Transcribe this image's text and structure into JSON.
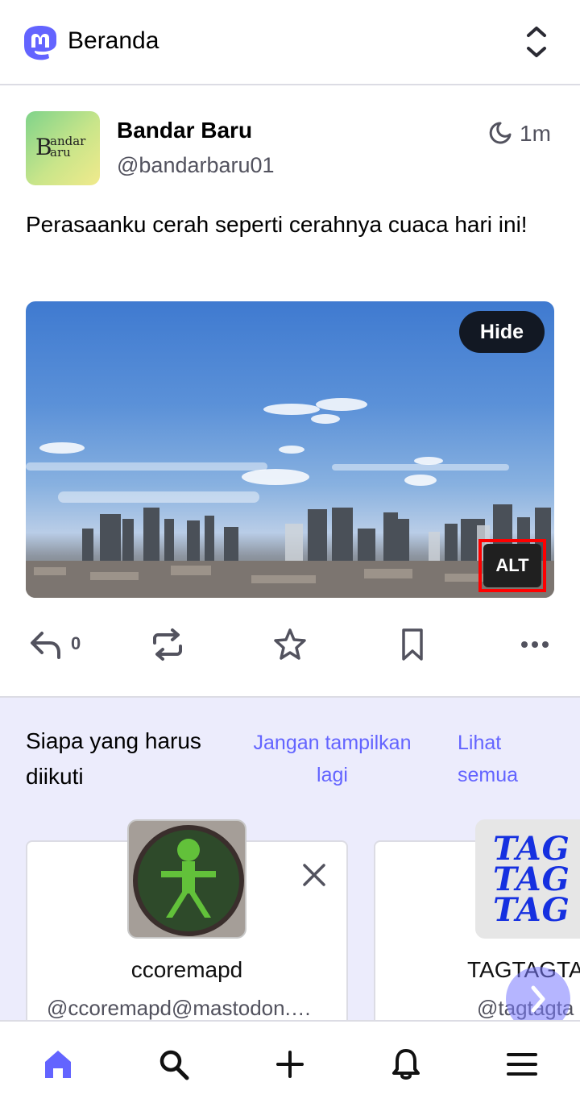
{
  "header": {
    "title": "Beranda",
    "logo_icon": "mastodon-logo-icon",
    "sort_icon": "chevron-up-down-icon"
  },
  "post": {
    "avatar_text_big": "B",
    "avatar_text_small1": "andar",
    "avatar_text_small2": "aru",
    "display_name": "Bandar Baru",
    "handle": "@bandarbaru01",
    "time": "1m",
    "visibility_icon": "moon-icon",
    "text": "Perasaanku cerah seperti cerahnya cuaca hari ini!",
    "media": {
      "hide_label": "Hide",
      "alt_label": "ALT"
    },
    "actions": {
      "reply_count": "0"
    }
  },
  "suggestions": {
    "title": "Siapa yang harus diikuti",
    "dismiss_label": "Jangan tampilkan lagi",
    "view_all_label": "Lihat semua",
    "cards": [
      {
        "name": "ccoremapd",
        "handle": "@ccoremapd@mastodon.…"
      },
      {
        "name": "TAGTAGTA",
        "handle": "@tagtagta",
        "avatar_text": [
          "TAG",
          "TAG",
          "TAG"
        ]
      }
    ]
  },
  "colors": {
    "accent": "#6364ff",
    "suggest_bg": "#ececfc",
    "border": "#dcdce4"
  },
  "bottom_nav": [
    "home-icon",
    "search-icon",
    "compose-plus-icon",
    "bell-icon",
    "menu-icon"
  ]
}
